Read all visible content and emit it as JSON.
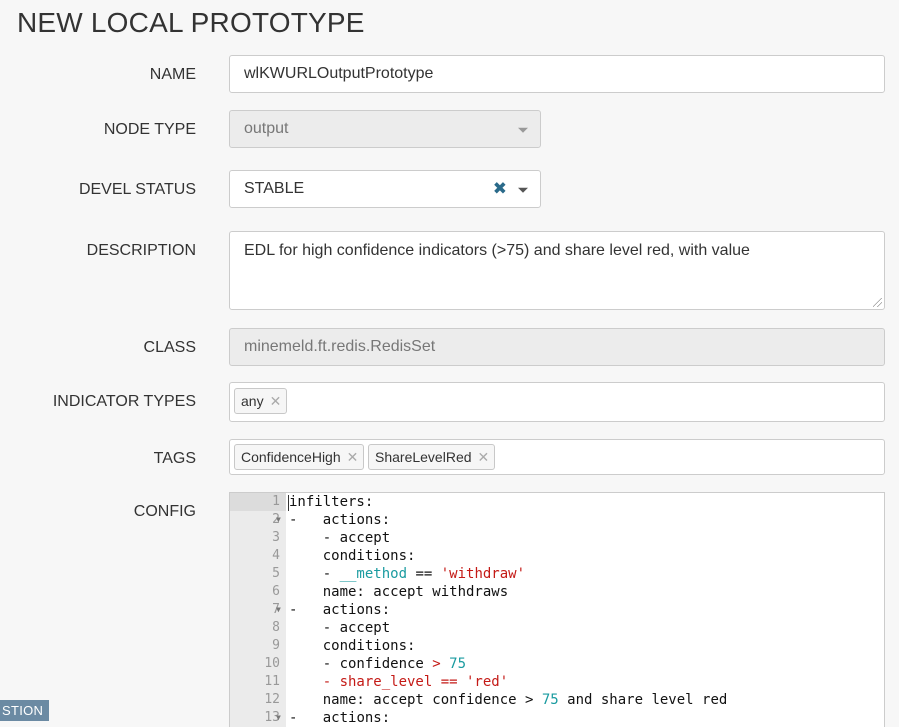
{
  "page_title": "NEW LOCAL PROTOTYPE",
  "form": {
    "name": {
      "label": "NAME",
      "value": "wlKWURLOutputPrototype"
    },
    "node_type": {
      "label": "NODE TYPE",
      "value": "output"
    },
    "devel_status": {
      "label": "DEVEL STATUS",
      "value": "STABLE"
    },
    "description": {
      "label": "DESCRIPTION",
      "value": "EDL for high confidence indicators (>75) and share level red, with value"
    },
    "class": {
      "label": "CLASS",
      "value": "minemeld.ft.redis.RedisSet"
    },
    "indicator_types": {
      "label": "INDICATOR TYPES",
      "tags": [
        "any"
      ]
    },
    "tags": {
      "label": "TAGS",
      "tags": [
        "ConfidenceHigh",
        "ShareLevelRed"
      ]
    },
    "config": {
      "label": "CONFIG"
    }
  },
  "editor": {
    "lines": [
      {
        "n": "1",
        "fold": false
      },
      {
        "n": "2",
        "fold": true
      },
      {
        "n": "3",
        "fold": false
      },
      {
        "n": "4",
        "fold": false
      },
      {
        "n": "5",
        "fold": false
      },
      {
        "n": "6",
        "fold": false
      },
      {
        "n": "7",
        "fold": true
      },
      {
        "n": "8",
        "fold": false
      },
      {
        "n": "9",
        "fold": false
      },
      {
        "n": "10",
        "fold": false
      },
      {
        "n": "11",
        "fold": false
      },
      {
        "n": "12",
        "fold": false
      },
      {
        "n": "13",
        "fold": true
      }
    ],
    "code": {
      "l1": "infilters:",
      "l2_dash": "-",
      "l2_key": "actions:",
      "l3": "- accept",
      "l4": "conditions:",
      "l5_dash": "- ",
      "l5_var": "__method",
      "l5_op": " == ",
      "l5_str": "'withdraw'",
      "l6": "name: accept withdraws",
      "l7_dash": "-",
      "l7_key": "actions:",
      "l8": "- accept",
      "l9": "conditions:",
      "l10_a": "- confidence ",
      "l10_op": ">",
      "l10_num": "75",
      "l11_a": "- share_level == 'red'",
      "l12_a": "name: accept confidence > ",
      "l12_num": "75",
      "l12_b": " and share level red",
      "l13_dash": "-",
      "l13_key": "actions:"
    }
  },
  "bottom_badge": "STION",
  "colors": {
    "accent": "#2a6a8a",
    "badge": "#6b8aa3",
    "string": "#c41a16",
    "number": "#1a9ba0"
  }
}
